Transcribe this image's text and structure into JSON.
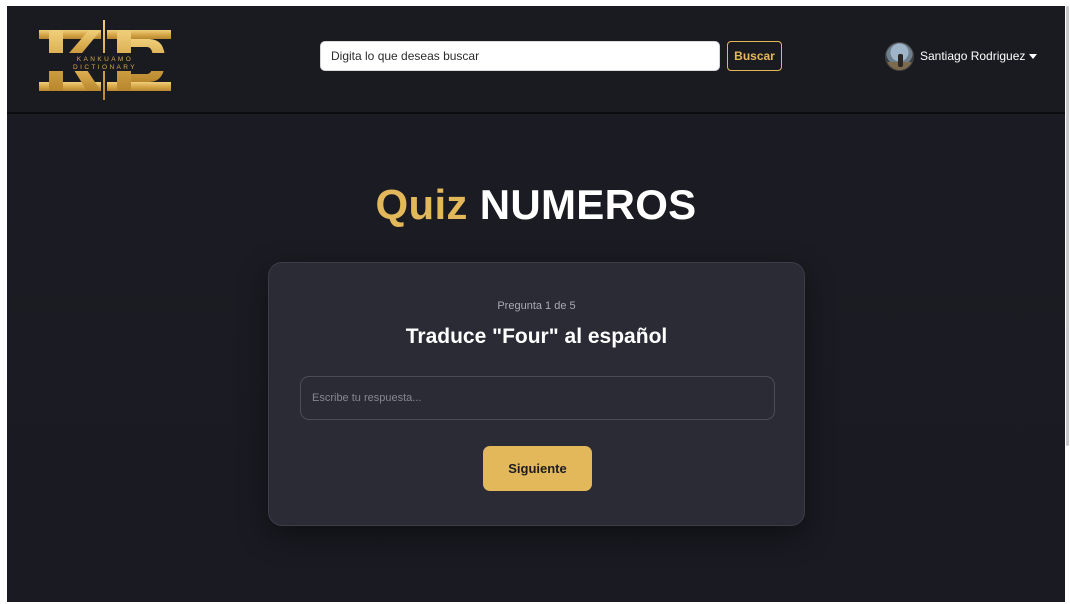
{
  "logo": {
    "letters": "KD",
    "brand_top": "KANKUAMO",
    "brand_bottom": "DICTIONARY"
  },
  "search": {
    "placeholder": "Digita lo que deseas buscar",
    "button_label": "Buscar"
  },
  "user": {
    "name": "Santiago Rodriguez"
  },
  "quiz": {
    "title_prefix": "Quiz",
    "title_topic": "NUMEROS",
    "counter": "Pregunta 1 de 5",
    "question": "Traduce \"Four\" al español",
    "answer_placeholder": "Escribe tu respuesta...",
    "next_label": "Siguiente"
  },
  "colors": {
    "accent": "#e3b85a",
    "background": "#1b1c23",
    "card": "#2a2b34"
  }
}
